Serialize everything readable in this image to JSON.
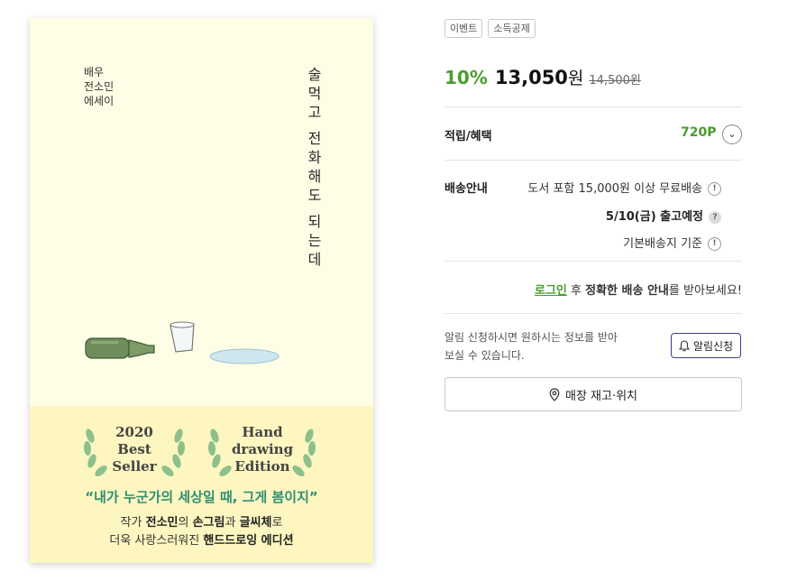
{
  "cover": {
    "author_lines": [
      "배우",
      "전소민",
      "에세이"
    ],
    "title_chars": [
      "술",
      "먹",
      "고",
      "",
      "전",
      "화",
      "해",
      "도",
      "",
      "되",
      "는",
      "데"
    ],
    "badge_left": [
      "2020",
      "Best",
      "Seller"
    ],
    "badge_right": [
      "Hand",
      "drawing",
      "Edition"
    ],
    "quote": "“내가 누군가의 세상일 때, 그게 봄이지”",
    "blurb_line1_a": "작가 ",
    "blurb_line1_b": "전소민",
    "blurb_line1_c": "의 ",
    "blurb_line1_d": "손그림",
    "blurb_line1_e": "과 ",
    "blurb_line1_f": "글씨체",
    "blurb_line1_g": "로",
    "blurb_line2_a": "더욱 사랑스러워진 ",
    "blurb_line2_b": "핸드드로잉 에디션"
  },
  "tags": [
    "이벤트",
    "소득공제"
  ],
  "price": {
    "discount": "10%",
    "sale": "13,050",
    "won": "원",
    "original": "14,500원"
  },
  "benefits": {
    "label": "적립/혜택",
    "points": "720P"
  },
  "shipping": {
    "label": "배송안내",
    "line1": "도서 포함 15,000원 이상 무료배송",
    "line2": "5/10(금) 출고예정",
    "line3": "기본배송지 기준"
  },
  "login": {
    "link": "로그인",
    "after": " 후 ",
    "bold": "정확한 배송 안내",
    "tail": "를 받아보세요!"
  },
  "notice": {
    "text": "알림 신청하시면 원하시는 정보를 받아 보실 수 있습니다.",
    "button": "알림신청"
  },
  "store_button": "매장 재고·위치",
  "colors": {
    "accent_green": "#4a9d2d",
    "cover_bg": "#fefee6",
    "cover_band": "#fdf6c0",
    "quote_teal": "#2e8f75"
  }
}
